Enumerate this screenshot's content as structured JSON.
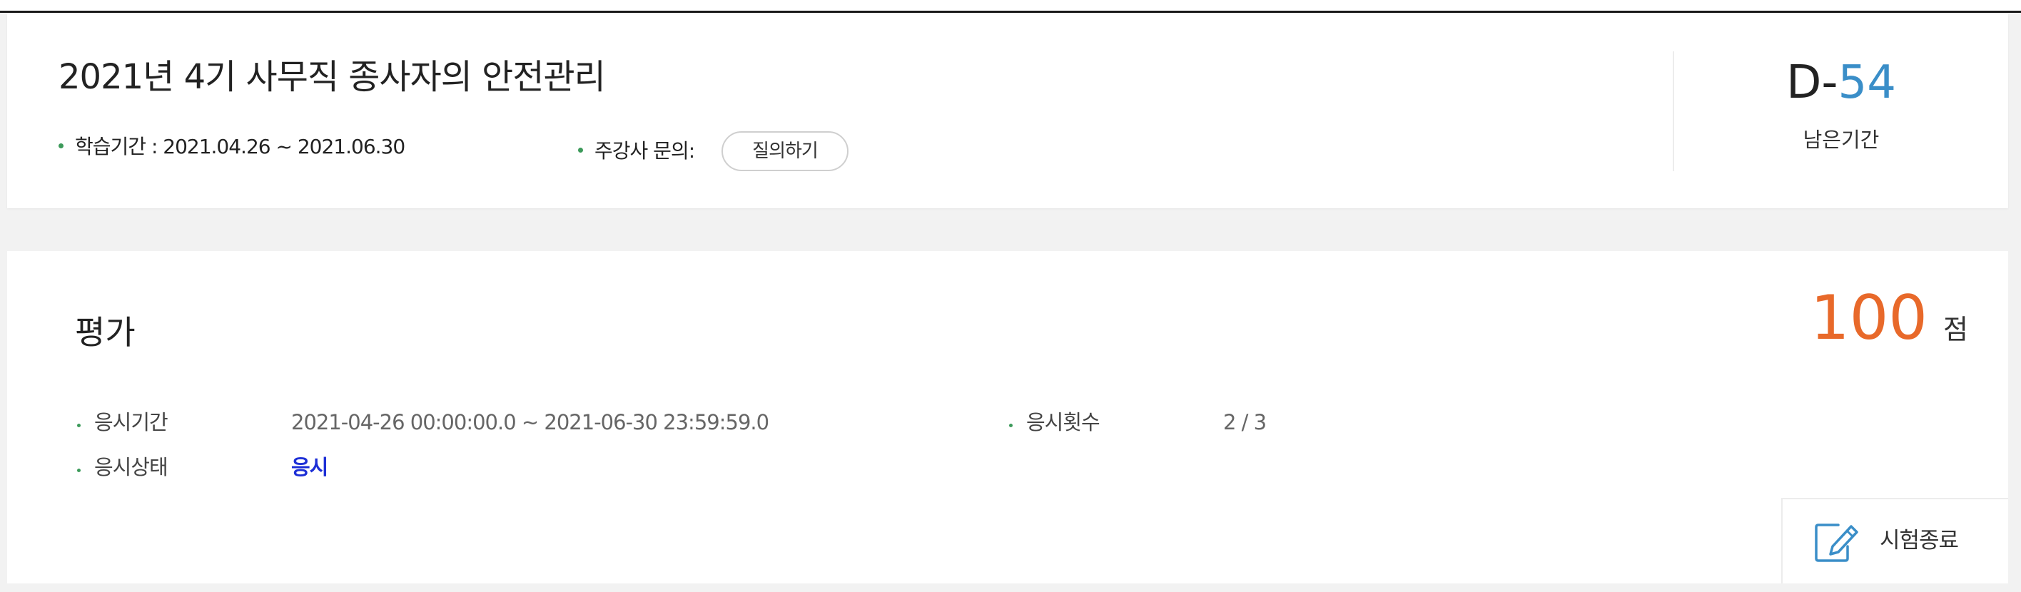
{
  "course": {
    "title": "2021년 4기 사무직 종사자의 안전관리",
    "period_text": "학습기간 : 2021.04.26 ~ 2021.06.30",
    "inquiry_label": "주강사 문의:",
    "ask_button": "질의하기",
    "dday_prefix": "D-",
    "dday_number": "54",
    "remaining_label": "남은기간"
  },
  "evaluation": {
    "title": "평가",
    "score": "100",
    "score_unit": "점",
    "exam_period_label": "응시기간",
    "exam_period_value": "2021-04-26 00:00:00.0 ~ 2021-06-30 23:59:59.0",
    "attempts_label": "응시횟수",
    "attempts_value": "2 / 3",
    "status_label": "응시상태",
    "status_value": "응시",
    "finish_button": "시험종료"
  },
  "icons": {
    "finish": "edit-icon",
    "bullet": "bullet-dot-icon"
  },
  "colors": {
    "dday_accent": "#3a8ec8",
    "score_accent": "#e8692a",
    "status_accent": "#1d2fd6",
    "bullet": "#3c9a5a"
  }
}
